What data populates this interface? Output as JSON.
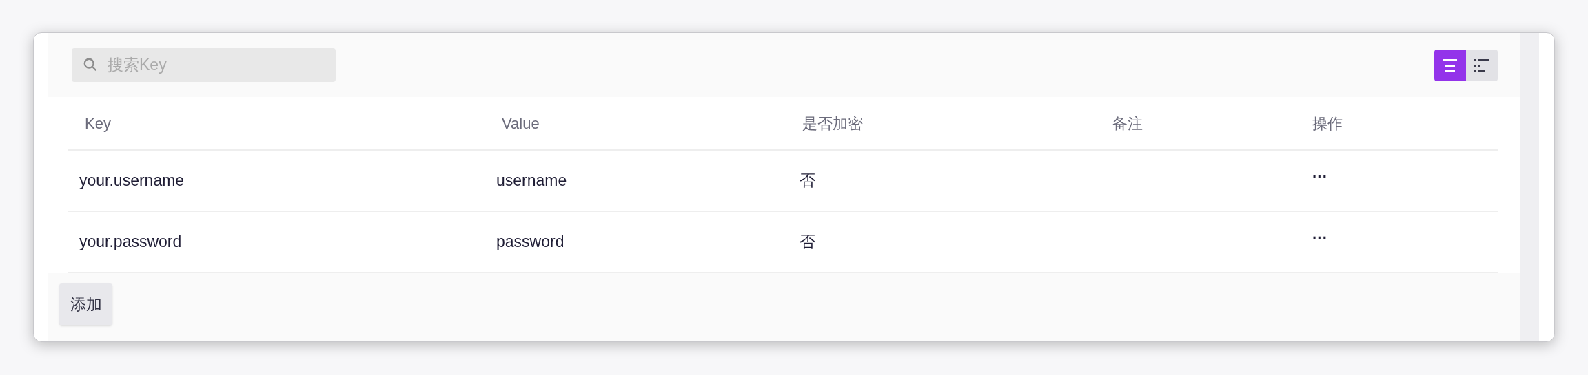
{
  "search": {
    "placeholder": "搜索Key"
  },
  "view_toggle": [
    {
      "kind": "list",
      "selected": true
    },
    {
      "kind": "detail",
      "selected": false
    }
  ],
  "table": {
    "columns": [
      "Key",
      "Value",
      "是否加密",
      "备注",
      "操作"
    ],
    "rows": [
      {
        "key": "your.username",
        "value": "username",
        "encrypted": "否",
        "actions": "···"
      },
      {
        "key": "your.password",
        "value": "password",
        "encrypted": "否",
        "actions": "···"
      }
    ]
  },
  "add_button": "添加"
}
